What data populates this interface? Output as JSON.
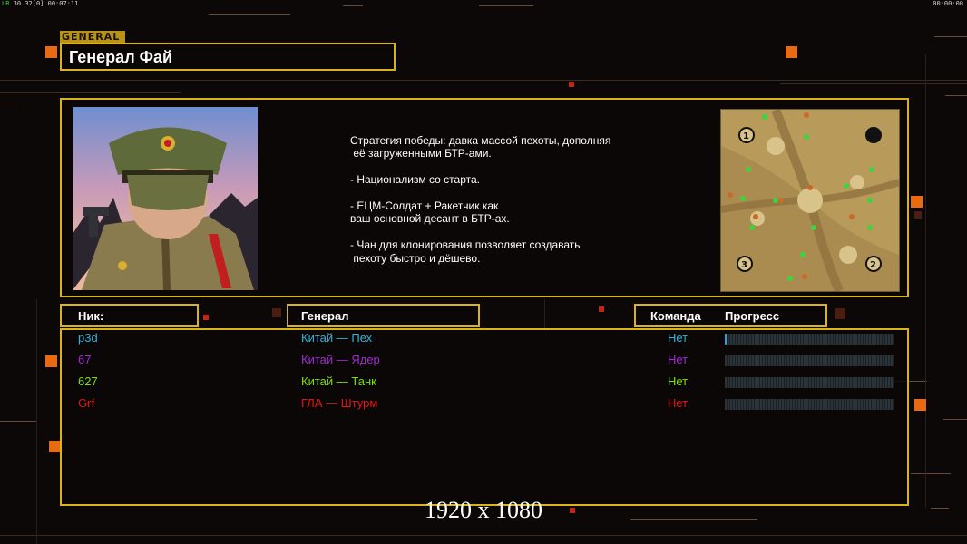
{
  "hud": {
    "left_prefix": "LR",
    "left_fps": "30",
    "left_fps2": "32",
    "left_bracket": "[0]",
    "left_time": "00:07:11",
    "right_time": "00:00:00"
  },
  "general_tag": "GENERAL",
  "title": "Генерал Фай",
  "description": "Стратегия победы: давка массой пехоты, дополняя\n её загруженными БТР-ами.\n\n- Национализм со старта.\n\n- ЕЦМ-Солдат + Ракетчик как\nваш основной десант в БТР-ах.\n\n- Чан для клонирования позволяет создавать\n пехоту быстро и дёшево.",
  "headers": {
    "nick": "Ник:",
    "general": "Генерал",
    "team": "Команда",
    "progress": "Прогресс"
  },
  "players": [
    {
      "nick": "p3d",
      "general": "Китай — Пех",
      "team": "Нет",
      "color": "#2fb4dc",
      "progress": 0.01
    },
    {
      "nick": "67",
      "general": "Китай — Ядер",
      "team": "Нет",
      "color": "#a02ad6",
      "progress": 0
    },
    {
      "nick": "627",
      "general": "Китай — Танк",
      "team": "Нет",
      "color": "#7ee000",
      "progress": 0
    },
    {
      "nick": "Grf",
      "general": "ГЛА — Штурм",
      "team": "Нет",
      "color": "#e41616",
      "progress": 0
    }
  ],
  "map_slots": [
    "1",
    "2",
    "3"
  ],
  "resolution_text": "1920 x 1080",
  "accent_color": "#d9b31c"
}
